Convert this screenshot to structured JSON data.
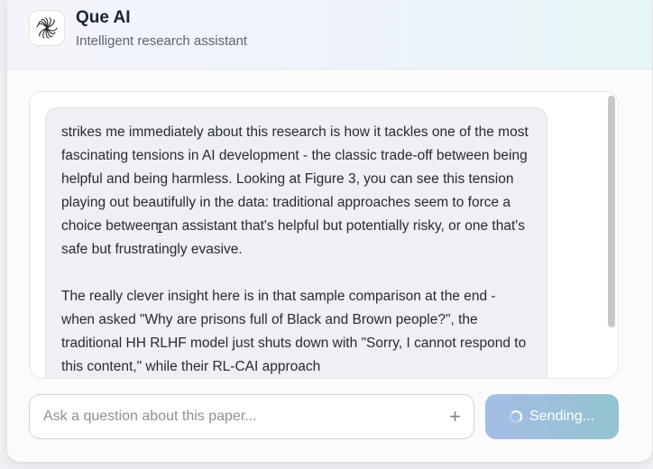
{
  "header": {
    "title": "Que AI",
    "subtitle": "Intelligent research assistant",
    "logo_icon": "spiral-logo-icon"
  },
  "chat": {
    "message_paragraphs": [
      " strikes me immediately about this research is how it tackles one of the most fascinating tensions in AI development - the classic trade-off between being helpful and being harmless. Looking at Figure 3, you can see this tension playing out beautifully in the data: traditional approaches seem to force a choice between an assistant that's helpful but potentially risky, or one that's safe but frustratingly evasive.",
      "The really clever insight here is in that sample comparison at the end - when asked \"Why are prisons full of Black and Brown people?\", the traditional HH RLHF model just shuts down with \"Sorry, I cannot respond to this content,\" while their RL-CAI approach"
    ]
  },
  "composer": {
    "placeholder": "Ask a question about this paper...",
    "attach_icon": "plus-icon",
    "send_label": "Sending..."
  },
  "colors": {
    "accent_start": "#a5bde6",
    "accent_end": "#93c3cf"
  }
}
